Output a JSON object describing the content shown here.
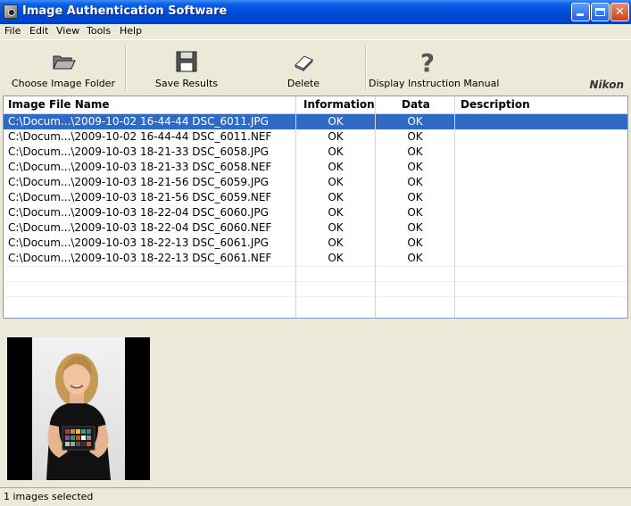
{
  "window": {
    "title": "Image Authentication Software",
    "controls": {
      "minimize": "minimize-icon",
      "maximize": "maximize-icon",
      "close": "close-icon"
    },
    "accent": "#0046cf"
  },
  "menu": [
    "File",
    "Edit",
    "View",
    "Tools",
    "Help"
  ],
  "toolbar": {
    "choose_folder": "Choose Image Folder",
    "save_results": "Save Results",
    "delete": "Delete",
    "help_manual": "Display Instruction Manual",
    "brand": "Nikon"
  },
  "table": {
    "headers": [
      "Image File Name",
      "Information",
      "Data",
      "Description"
    ],
    "selection_color": "#316ac5",
    "rows": [
      {
        "file": "C:\\Docum...\\2009-10-02 16-44-44 DSC_6011.JPG",
        "info": "OK",
        "data": "OK",
        "desc": ""
      },
      {
        "file": "C:\\Docum...\\2009-10-02 16-44-44 DSC_6011.NEF",
        "info": "OK",
        "data": "OK",
        "desc": ""
      },
      {
        "file": "C:\\Docum...\\2009-10-03 18-21-33 DSC_6058.JPG",
        "info": "OK",
        "data": "OK",
        "desc": ""
      },
      {
        "file": "C:\\Docum...\\2009-10-03 18-21-33 DSC_6058.NEF",
        "info": "OK",
        "data": "OK",
        "desc": ""
      },
      {
        "file": "C:\\Docum...\\2009-10-03 18-21-56 DSC_6059.JPG",
        "info": "OK",
        "data": "OK",
        "desc": ""
      },
      {
        "file": "C:\\Docum...\\2009-10-03 18-21-56 DSC_6059.NEF",
        "info": "OK",
        "data": "OK",
        "desc": ""
      },
      {
        "file": "C:\\Docum...\\2009-10-03 18-22-04 DSC_6060.JPG",
        "info": "OK",
        "data": "OK",
        "desc": ""
      },
      {
        "file": "C:\\Docum...\\2009-10-03 18-22-04 DSC_6060.NEF",
        "info": "OK",
        "data": "OK",
        "desc": ""
      },
      {
        "file": "C:\\Docum...\\2009-10-03 18-22-13 DSC_6061.JPG",
        "info": "OK",
        "data": "OK",
        "desc": ""
      },
      {
        "file": "C:\\Docum...\\2009-10-03 18-22-13 DSC_6061.NEF",
        "info": "OK",
        "data": "OK",
        "desc": ""
      }
    ]
  },
  "status": {
    "text": "1 images selected"
  }
}
